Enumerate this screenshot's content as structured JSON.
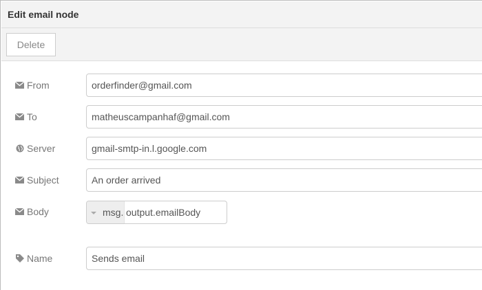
{
  "header": {
    "title": "Edit email node"
  },
  "toolbar": {
    "delete_label": "Delete"
  },
  "form": {
    "from": {
      "label": "From",
      "value": "orderfinder@gmail.com",
      "icon": "envelope-icon"
    },
    "to": {
      "label": "To",
      "value": "matheuscampanhaf@gmail.com",
      "icon": "envelope-icon"
    },
    "server": {
      "label": "Server",
      "value": "gmail-smtp-in.l.google.com",
      "icon": "globe-icon"
    },
    "subject": {
      "label": "Subject",
      "value": "An order arrived",
      "icon": "envelope-icon"
    },
    "body": {
      "label": "Body",
      "type_prefix": "msg.",
      "value": "output.emailBody",
      "icon": "envelope-icon"
    },
    "name": {
      "label": "Name",
      "value": "Sends email",
      "icon": "tag-icon"
    }
  }
}
